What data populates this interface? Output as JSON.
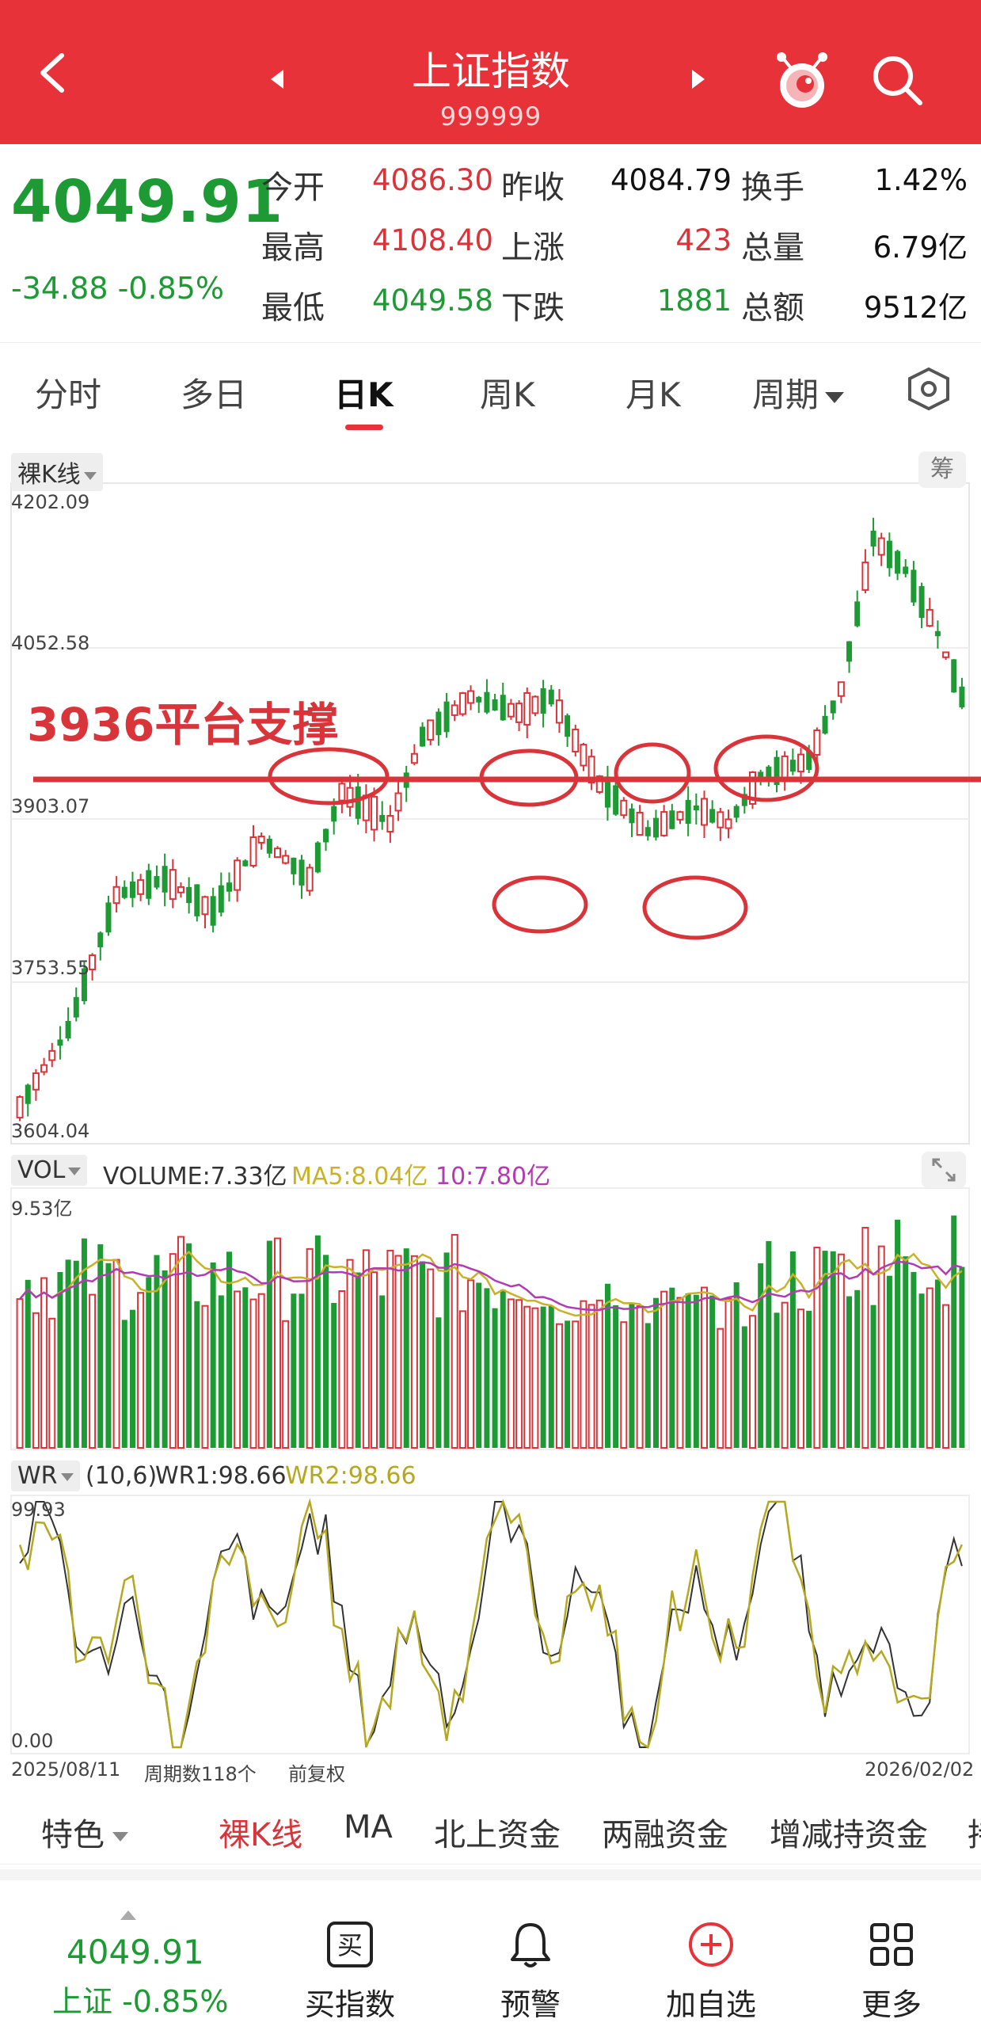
{
  "header": {
    "title": "上证指数",
    "code": "999999"
  },
  "quote": {
    "price": "4049.91",
    "change": "-34.88 -0.85%",
    "open_label": "今开",
    "open": "4086.30",
    "prev_close_label": "昨收",
    "prev_close": "4084.79",
    "turnover_label": "换手",
    "turnover": "1.42%",
    "high_label": "最高",
    "high": "4108.40",
    "up_label": "上涨",
    "up_count": "423",
    "volume_label": "总量",
    "volume": "6.79亿",
    "low_label": "最低",
    "low": "4049.58",
    "down_label": "下跌",
    "down_count": "1881",
    "amount_label": "总额",
    "amount": "9512亿"
  },
  "tabs": [
    "分时",
    "多日",
    "日K",
    "周K",
    "月K",
    "周期"
  ],
  "active_tab": "日K",
  "chart": {
    "kline_mode": "裸K线",
    "chip_label": "筹",
    "y_ticks": [
      "4202.09",
      "4052.58",
      "3903.07",
      "3753.55",
      "3604.04"
    ],
    "annotation": "3936平台支撑",
    "annotation_color": "#d8343a",
    "vol_label": "VOL",
    "vol_volume": "VOLUME:7.33亿",
    "vol_ma5": "MA5:8.04亿",
    "vol_ma10": "10:7.80亿",
    "vol_max": "9.53亿",
    "wr_label": "WR",
    "wr_params": "(10,6)",
    "wr1": "WR1:98.66",
    "wr2": "WR2:98.66",
    "wr_max": "99.93",
    "wr_min": "0.00",
    "date_start": "2025/08/11",
    "period_count": "周期数118个",
    "adjust": "前复权",
    "date_end": "2026/02/02"
  },
  "indicators": [
    "特色",
    "裸K线",
    "MA",
    "北上资金",
    "两融资金",
    "增减持资金",
    "持"
  ],
  "active_indicator": "裸K线",
  "bottom": {
    "price": "4049.91",
    "sub": "上证 -0.85%",
    "actions": [
      "买指数",
      "预警",
      "加自选",
      "更多"
    ],
    "buy_icon_char": "买"
  },
  "colors": {
    "brand": "#e63238",
    "up": "#d8343a",
    "down": "#1e9a34"
  }
}
